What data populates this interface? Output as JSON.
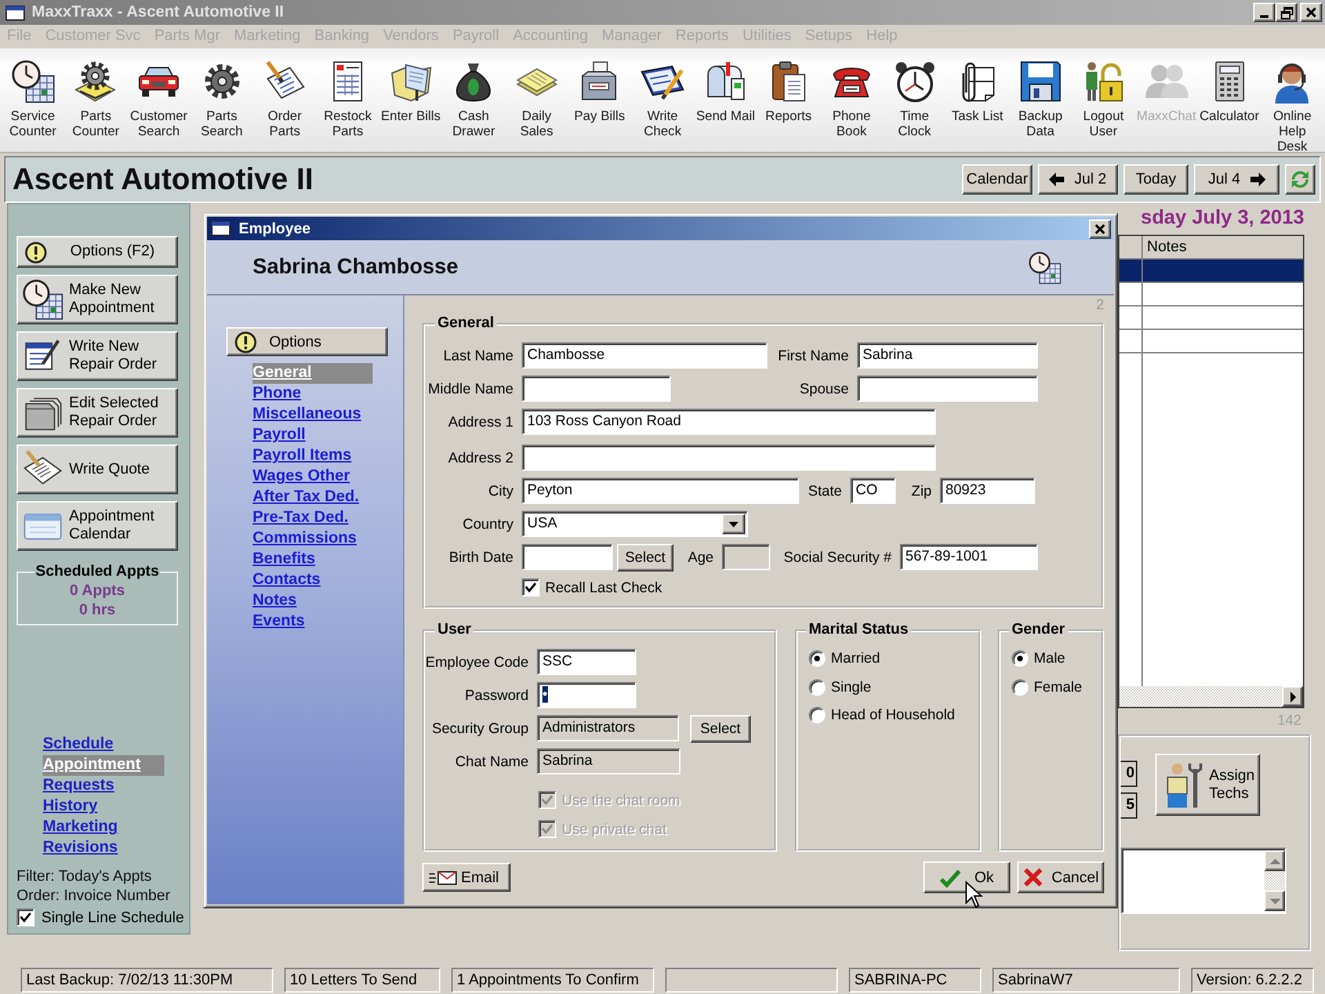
{
  "window": {
    "title": "MaxxTraxx - Ascent Automotive II"
  },
  "menu": {
    "disabled": true,
    "items": [
      "File",
      "Customer Svc",
      "Parts Mgr",
      "Marketing",
      "Banking",
      "Vendors",
      "Payroll",
      "Accounting",
      "Manager",
      "Reports",
      "Utilities",
      "Setups",
      "Help"
    ]
  },
  "toolbar": [
    {
      "label": "Service\nCounter",
      "disabled": false
    },
    {
      "label": "Parts\nCounter",
      "disabled": false
    },
    {
      "label": "Customer\nSearch",
      "disabled": false
    },
    {
      "label": "Parts\nSearch",
      "disabled": false
    },
    {
      "label": "Order\nParts",
      "disabled": false
    },
    {
      "label": "Restock\nParts",
      "disabled": false
    },
    {
      "label": "Enter Bills",
      "disabled": false
    },
    {
      "label": "Cash\nDrawer",
      "disabled": false
    },
    {
      "label": "Daily\nSales",
      "disabled": false
    },
    {
      "label": "Pay Bills",
      "disabled": false
    },
    {
      "label": "Write\nCheck",
      "disabled": false
    },
    {
      "label": "Send Mail",
      "disabled": false
    },
    {
      "label": "Reports",
      "disabled": false
    },
    {
      "label": "Phone\nBook",
      "disabled": false
    },
    {
      "label": "Time\nClock",
      "disabled": false
    },
    {
      "label": "Task List",
      "disabled": false
    },
    {
      "label": "Backup\nData",
      "disabled": false
    },
    {
      "label": "Logout\nUser",
      "disabled": false
    },
    {
      "label": "MaxxChat",
      "disabled": true
    },
    {
      "label": "Calculator",
      "disabled": false
    },
    {
      "label": "Online\nHelp\nDesk",
      "disabled": false
    }
  ],
  "header": {
    "title": "Ascent Automotive II",
    "nav": [
      {
        "label": "Calendar",
        "kind": "calendar"
      },
      {
        "label": "Jul 2",
        "kind": "prev"
      },
      {
        "label": "Today",
        "kind": "today"
      },
      {
        "label": "Jul 4",
        "kind": "next"
      }
    ]
  },
  "sidebar": {
    "buttons": [
      {
        "label": "Options (F2)",
        "kind": "options"
      },
      {
        "label": "Make New\nAppointment",
        "kind": "action"
      },
      {
        "label": "Write New\nRepair Order",
        "kind": "action"
      },
      {
        "label": "Edit Selected\nRepair Order",
        "kind": "action"
      },
      {
        "label": "Write Quote",
        "kind": "action"
      },
      {
        "label": "Appointment\nCalendar",
        "kind": "action"
      }
    ],
    "scheduled": {
      "title": "Scheduled Appts",
      "appts": "0 Appts",
      "hours": "0 hrs"
    },
    "links": [
      {
        "label": "Schedule",
        "selected": false
      },
      {
        "label": "Appointment",
        "selected": true
      },
      {
        "label": "Requests",
        "selected": false
      },
      {
        "label": "History",
        "selected": false
      },
      {
        "label": "Marketing",
        "selected": false
      },
      {
        "label": "Revisions",
        "selected": false
      }
    ],
    "filter": "Filter: Today's Appts",
    "order": "Order: Invoice Number",
    "single_line": {
      "label": "Single Line Schedule",
      "checked": true
    }
  },
  "schedule": {
    "date": "sday July 3, 2013",
    "columns": [
      "Notes"
    ],
    "rows": [
      {
        "selected": true
      },
      {
        "selected": false
      },
      {
        "selected": false
      },
      {
        "selected": false
      }
    ],
    "count": "142",
    "partial_fields": [
      "0",
      "5"
    ],
    "assign_button": "Assign Techs"
  },
  "dialog": {
    "title": "Employee",
    "name": "Sabrina Chambosse",
    "page": "2",
    "options_button": "Options",
    "nav": [
      {
        "label": "General",
        "selected": true
      },
      {
        "label": "Phone",
        "selected": false
      },
      {
        "label": "Miscellaneous",
        "selected": false
      },
      {
        "label": "Payroll",
        "selected": false
      },
      {
        "label": "Payroll Items",
        "selected": false
      },
      {
        "label": "Wages Other",
        "selected": false
      },
      {
        "label": "After Tax Ded.",
        "selected": false
      },
      {
        "label": "Pre-Tax Ded.",
        "selected": false
      },
      {
        "label": "Commissions",
        "selected": false
      },
      {
        "label": "Benefits",
        "selected": false
      },
      {
        "label": "Contacts",
        "selected": false
      },
      {
        "label": "Notes",
        "selected": false
      },
      {
        "label": "Events",
        "selected": false
      }
    ],
    "general": {
      "title": "General",
      "last_name": {
        "label": "Last Name",
        "value": "Chambosse"
      },
      "first_name": {
        "label": "First Name",
        "value": "Sabrina"
      },
      "middle_name": {
        "label": "Middle Name"
      },
      "spouse": {
        "label": "Spouse"
      },
      "address_1": {
        "label": "Address 1",
        "value": "103 Ross Canyon Road"
      },
      "address_2": {
        "label": "Address 2"
      },
      "city": {
        "label": "City",
        "value": "Peyton"
      },
      "state": {
        "label": "State",
        "value": "CO"
      },
      "zip": {
        "label": "Zip",
        "value": "80923"
      },
      "country": {
        "label": "Country",
        "value": "USA"
      },
      "birth_date": {
        "label": "Birth Date",
        "button": "Select"
      },
      "age": {
        "label": "Age",
        "disabled": true
      },
      "ssn": {
        "label": "Social Security #",
        "value": "567-89-1001"
      },
      "recall_last_check": {
        "label": "Recall Last Check",
        "checked": true
      }
    },
    "user": {
      "title": "User",
      "employee_code": {
        "label": "Employee Code",
        "value": "SSC"
      },
      "password": {
        "label": "Password",
        "value": "•",
        "value_selected": true
      },
      "security_group": {
        "label": "Security Group",
        "value": "Administrators",
        "disabled": true,
        "button": "Select"
      },
      "chat_name": {
        "label": "Chat Name",
        "value": "Sabrina",
        "disabled": true
      },
      "options": [
        {
          "label": "Use the chat room",
          "checked": true,
          "disabled": true
        },
        {
          "label": "Use private chat",
          "checked": true,
          "disabled": true
        }
      ]
    },
    "marital_status": {
      "title": "Marital Status",
      "options": [
        {
          "label": "Married",
          "selected": true
        },
        {
          "label": "Single",
          "selected": false
        },
        {
          "label": "Head of Household",
          "selected": false
        }
      ]
    },
    "gender": {
      "title": "Gender",
      "options": [
        {
          "label": "Male",
          "selected": true
        },
        {
          "label": "Female",
          "selected": false
        }
      ]
    },
    "buttons": {
      "email": "Email",
      "ok": "Ok",
      "cancel": "Cancel"
    }
  },
  "status_bar": [
    "Last Backup: 7/02/13 11:30PM",
    "10 Letters To Send",
    "1 Appointments To Confirm",
    "SABRINA-PC",
    "SabrinaW7",
    "Version: 6.2.2.2"
  ]
}
